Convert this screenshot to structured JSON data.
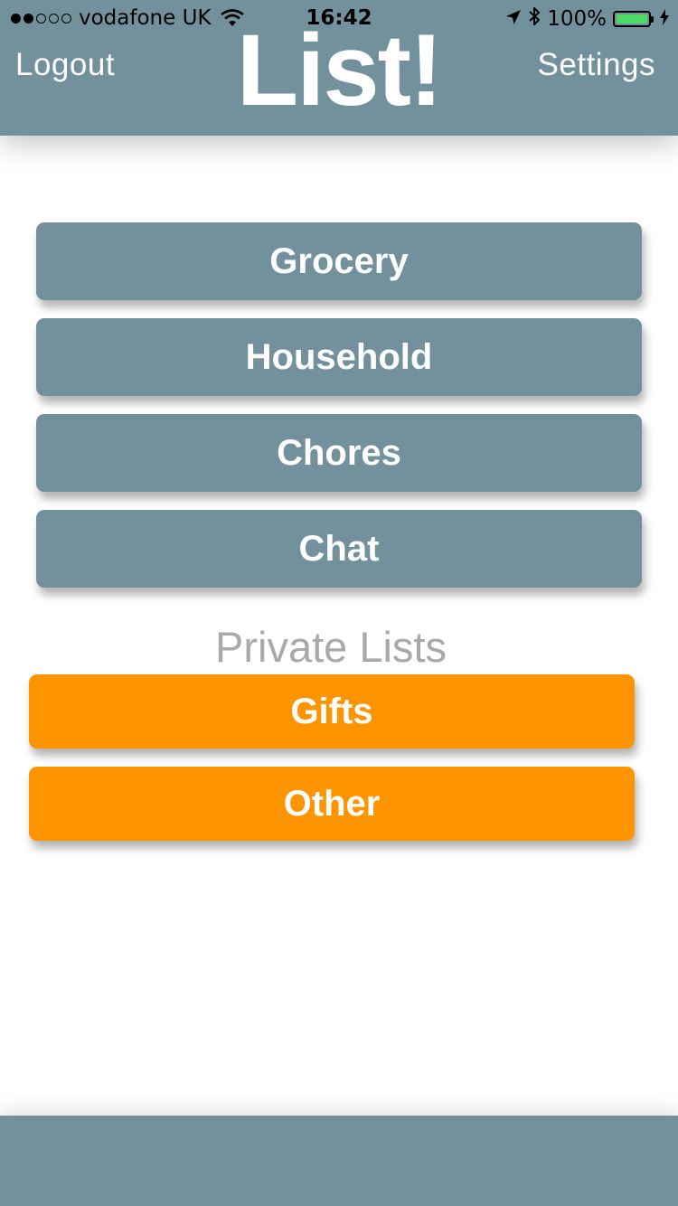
{
  "status_bar": {
    "carrier": "vodafone UK",
    "signal_bars_filled": 2,
    "signal_bars_total": 5,
    "time": "16:42",
    "battery_percent": "100%",
    "battery_fill": 1.0,
    "icons": [
      "wifi-icon",
      "location-arrow-icon",
      "bluetooth-icon",
      "battery-icon",
      "charging-bolt-icon"
    ]
  },
  "header": {
    "logout_label": "Logout",
    "title": "List!",
    "settings_label": "Settings",
    "background_color": "#73909d"
  },
  "shared_lists": [
    {
      "label": "Grocery"
    },
    {
      "label": "Household"
    },
    {
      "label": "Chores"
    },
    {
      "label": "Chat"
    }
  ],
  "private_section": {
    "title": "Private Lists",
    "items": [
      {
        "label": "Gifts"
      },
      {
        "label": "Other"
      }
    ]
  },
  "colors": {
    "shared_button": "#73909d",
    "private_button": "#fd9400",
    "footer": "#73909d",
    "section_title": "#a9a9a9"
  }
}
